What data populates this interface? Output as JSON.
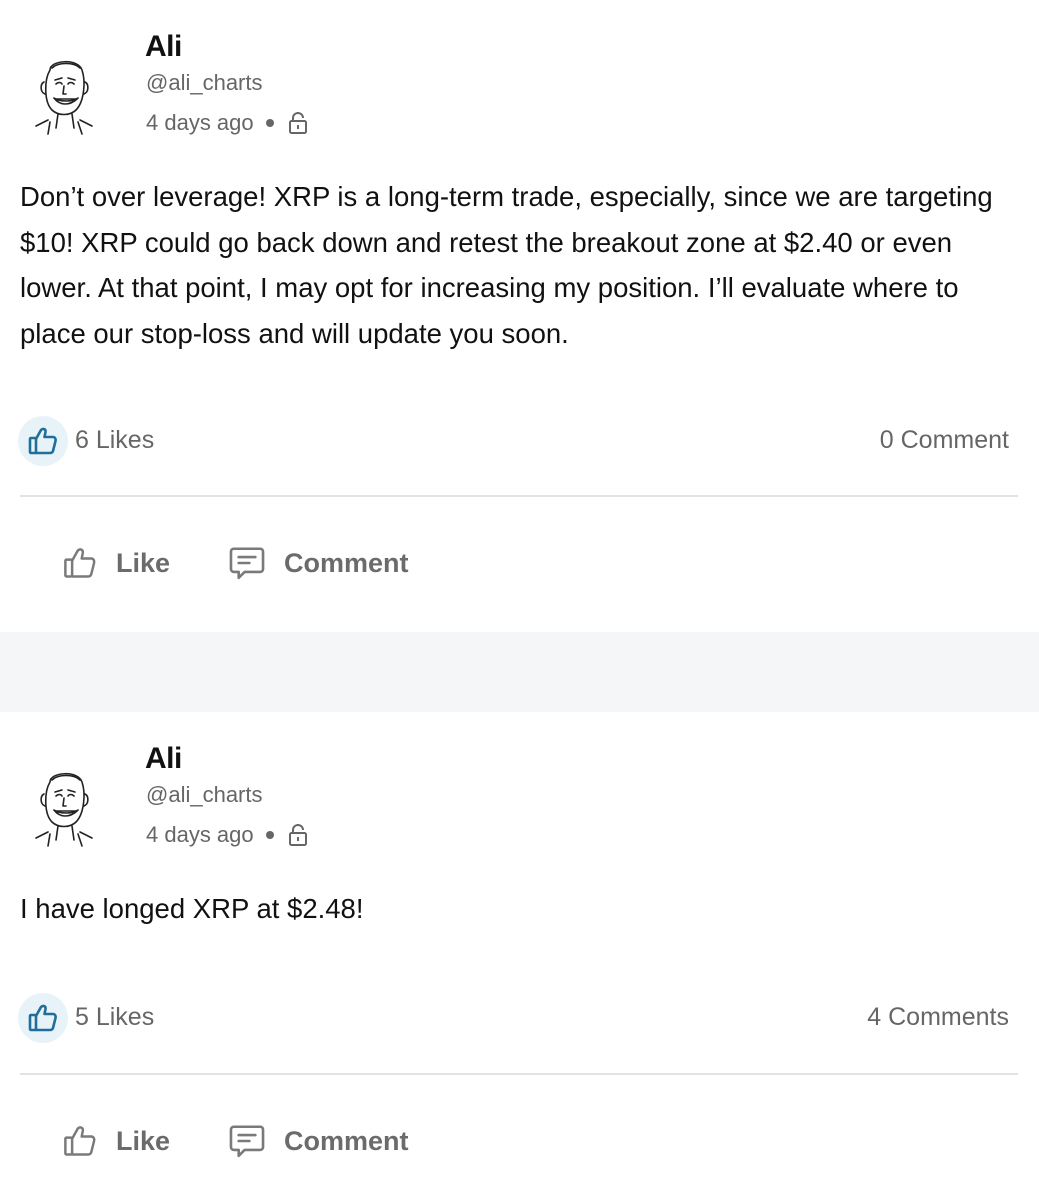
{
  "posts": [
    {
      "author": "Ali",
      "handle": "@ali_charts",
      "time": "4 days ago",
      "body": "Don’t over leverage!  XRP is a long-term trade, especially, since we are targeting $10! XRP could go back down and retest the breakout zone at $2.40 or even lower. At that point, I may opt for increasing my position. I’ll evaluate where to place our stop-loss and will update you soon.",
      "likes": "6 Likes",
      "comments": "0 Comment",
      "like_label": "Like",
      "comment_label": "Comment"
    },
    {
      "author": "Ali",
      "handle": "@ali_charts",
      "time": "4 days ago",
      "body": "I have longed XRP at $2.48!",
      "likes": "5 Likes",
      "comments": "4 Comments",
      "like_label": "Like",
      "comment_label": "Comment"
    }
  ],
  "colors": {
    "accent": "#1f6f9a",
    "muted": "#666666",
    "separator": "#f5f6f8",
    "like_badge_bg": "#e8f3f9"
  }
}
